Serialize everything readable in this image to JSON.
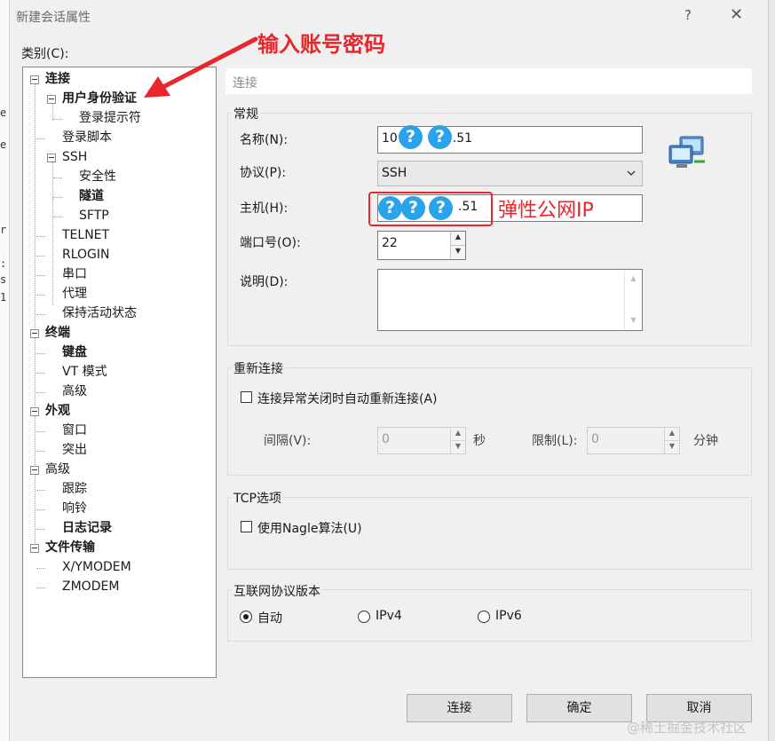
{
  "background_terminal": {
    "chars": [
      "e",
      "e",
      "r",
      ":",
      "s",
      "1"
    ]
  },
  "dialog": {
    "title": "新建会话属性",
    "help_glyph": "?",
    "close_glyph": "✕"
  },
  "category": {
    "label": "类别(C):",
    "tree": [
      {
        "label": "连接",
        "bold": true
      },
      {
        "label": "用户身份验证",
        "bold": true
      },
      {
        "label": "登录提示符",
        "bold": false
      },
      {
        "label": "登录脚本",
        "bold": false
      },
      {
        "label": "SSH",
        "bold": false
      },
      {
        "label": "安全性",
        "bold": false
      },
      {
        "label": "隧道",
        "bold": true
      },
      {
        "label": "SFTP",
        "bold": false
      },
      {
        "label": "TELNET",
        "bold": false
      },
      {
        "label": "RLOGIN",
        "bold": false
      },
      {
        "label": "串口",
        "bold": false
      },
      {
        "label": "代理",
        "bold": false
      },
      {
        "label": "保持活动状态",
        "bold": false
      },
      {
        "label": "终端",
        "bold": true
      },
      {
        "label": "键盘",
        "bold": true
      },
      {
        "label": "VT 模式",
        "bold": false
      },
      {
        "label": "高级",
        "bold": false
      },
      {
        "label": "外观",
        "bold": true
      },
      {
        "label": "窗口",
        "bold": false
      },
      {
        "label": "突出",
        "bold": false
      },
      {
        "label": "高级",
        "bold": false
      },
      {
        "label": "跟踪",
        "bold": false
      },
      {
        "label": "响铃",
        "bold": false
      },
      {
        "label": "日志记录",
        "bold": true
      },
      {
        "label": "文件传输",
        "bold": true
      },
      {
        "label": "X/YMODEM",
        "bold": false
      },
      {
        "label": "ZMODEM",
        "bold": false
      }
    ]
  },
  "annotations": {
    "arrow_text": "输入账号密码",
    "ip_text": "弹性公网IP",
    "qmark": "?",
    "color": "#e8262b"
  },
  "panel": {
    "header": "连接",
    "general": {
      "title": "常规",
      "name_label": "名称(N):",
      "name_value_start": "10",
      "name_value_end": ".51",
      "protocol_label": "协议(P):",
      "protocol_value": "SSH",
      "host_label": "主机(H):",
      "host_value_end": ".51",
      "port_label": "端口号(O):",
      "port_value": "22",
      "desc_label": "说明(D):",
      "desc_value": ""
    },
    "reconnect": {
      "title": "重新连接",
      "checkbox_label": "连接异常关闭时自动重新连接(A)",
      "checked": false,
      "interval_label": "间隔(V):",
      "interval_value": "0",
      "interval_unit": "秒",
      "limit_label": "限制(L):",
      "limit_value": "0",
      "limit_unit": "分钟"
    },
    "tcp": {
      "title": "TCP选项",
      "nagle_label": "使用Nagle算法(U)",
      "checked": false
    },
    "ip_version": {
      "title": "互联网协议版本",
      "options": [
        "自动",
        "IPv4",
        "IPv6"
      ],
      "selected": "自动"
    }
  },
  "buttons": {
    "connect": "连接",
    "ok": "确定",
    "cancel": "取消"
  },
  "watermark": "@稀土掘金技术社区"
}
